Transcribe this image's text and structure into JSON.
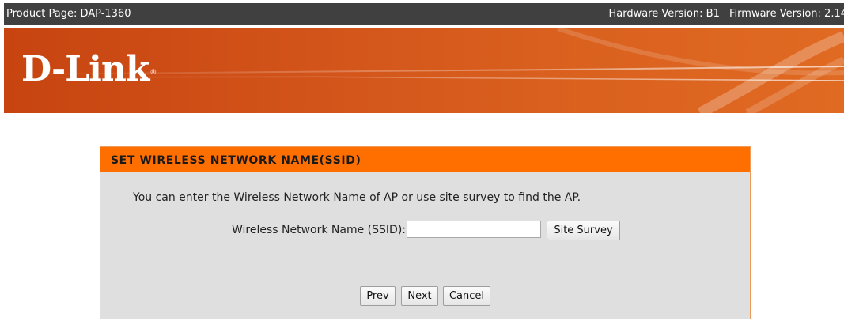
{
  "topbar": {
    "product": "Product Page: DAP-1360",
    "hardware": "Hardware Version: B1",
    "firmware": "Firmware Version: 2.14"
  },
  "banner": {
    "logo_text": "D-Link",
    "logo_mark": "®"
  },
  "panel": {
    "title": "SET WIRELESS NETWORK NAME(SSID)",
    "description": "You can enter the Wireless Network Name of AP or use site survey to find the AP.",
    "ssid_label": "Wireless Network Name (SSID):",
    "ssid_value": "",
    "site_survey_label": "Site Survey",
    "prev_label": "Prev",
    "next_label": "Next",
    "cancel_label": "Cancel"
  },
  "colors": {
    "topbar_bg": "#404040",
    "banner_orange": "#d9601e",
    "panel_header": "#ff6f00",
    "panel_bg": "#dfdfdf"
  }
}
